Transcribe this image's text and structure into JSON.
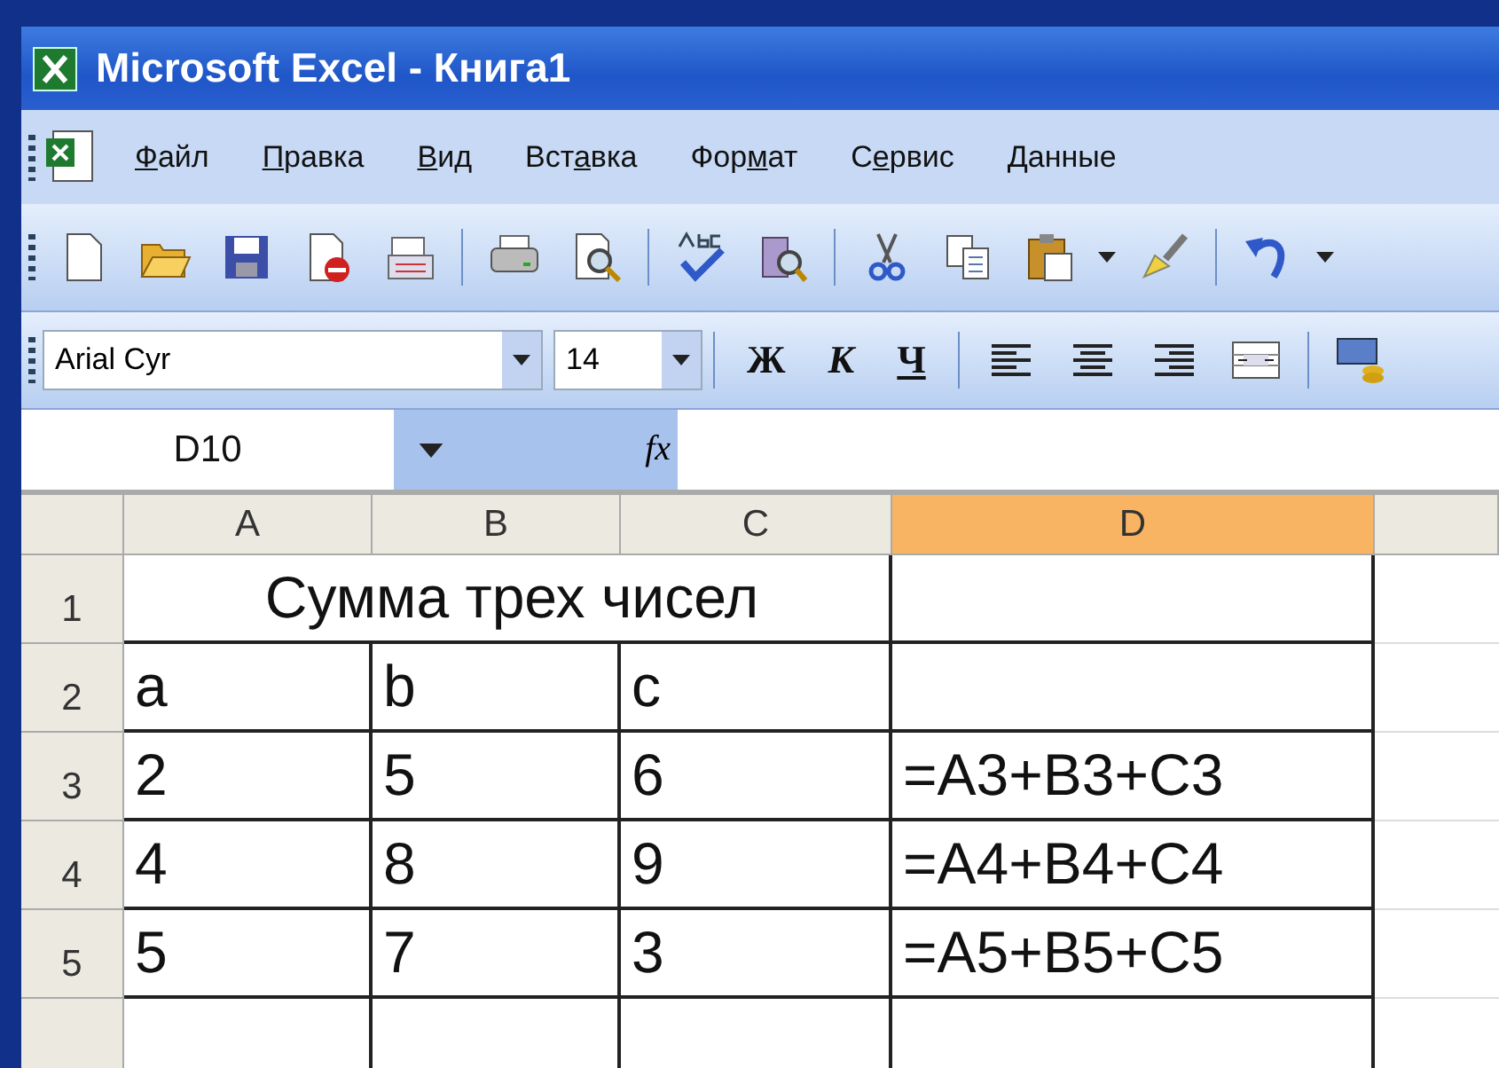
{
  "window": {
    "title": "Microsoft Excel - Книга1"
  },
  "menu": [
    {
      "key": "Ф",
      "post": "айл"
    },
    {
      "key": "П",
      "post": "равка"
    },
    {
      "key": "В",
      "post": "ид"
    },
    {
      "pre": "Вст",
      "key": "а",
      "post": "вка"
    },
    {
      "pre": "Фор",
      "key": "м",
      "post": "ат"
    },
    {
      "pre": "С",
      "key": "е",
      "post": "рвис"
    },
    {
      "key": "Д",
      "post": "анные"
    }
  ],
  "formatting": {
    "font": "Arial Cyr",
    "size": "14",
    "bold": "Ж",
    "italic": "К",
    "underline": "Ч"
  },
  "formula_bar": {
    "name_box": "D10",
    "fx": "fx"
  },
  "sheet": {
    "columns": [
      {
        "label": "A",
        "selected": false
      },
      {
        "label": "B",
        "selected": false
      },
      {
        "label": "C",
        "selected": false
      },
      {
        "label": "D",
        "selected": true
      }
    ],
    "rows": [
      {
        "label": "1",
        "kind": "merged",
        "text": "Сумма трех чисел"
      },
      {
        "label": "2",
        "kind": "values",
        "cells": [
          "a",
          "b",
          "c"
        ]
      },
      {
        "label": "3",
        "kind": "values",
        "cells": [
          "2",
          "5",
          "6",
          "=A3+B3+C3"
        ]
      },
      {
        "label": "4",
        "kind": "values",
        "cells": [
          "4",
          "8",
          "9",
          "=A4+B4+C4"
        ]
      },
      {
        "label": "5",
        "kind": "values",
        "cells": [
          "5",
          "7",
          "3",
          "=A5+B5+C5"
        ]
      }
    ]
  }
}
